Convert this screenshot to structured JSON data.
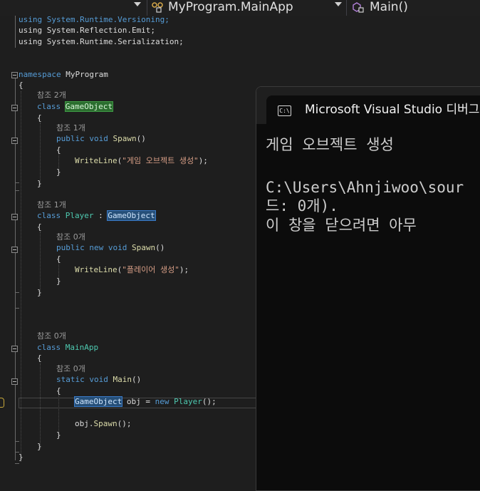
{
  "navbar": {
    "class_dropdown": "MyProgram.MainApp",
    "member_dropdown": "Main()",
    "class_icon": "class-icon",
    "member_icon": "method-icon",
    "dropdown_icon": "chevron-down-icon"
  },
  "editor": {
    "usings": [
      "using System.Runtime.Versioning;",
      "using System.Reflection.Emit;",
      "using System.Runtime.Serialization;"
    ],
    "ns": {
      "kw": "namespace",
      "name": "MyProgram"
    },
    "brace_open": "{",
    "brace_close": "}",
    "gameobject": {
      "refs": "참조 2개",
      "kw": "class",
      "name": "GameObject",
      "spawn_refs": "참조 1개",
      "spawn_mods": "public void",
      "spawn_name": "Spawn",
      "parens": "()",
      "call": "WriteLine",
      "str": "\"게임 오브젝트 생성\"",
      "call_end": ");",
      "call_open": "("
    },
    "player": {
      "refs": "참조 1개",
      "kw": "class",
      "name": "Player",
      "colon": " : ",
      "base": "GameObject",
      "spawn_refs": "참조 0개",
      "spawn_mods": "public new void",
      "spawn_name": "Spawn",
      "parens": "()",
      "call": "WriteLine",
      "str": "\"플레이어 생성\"",
      "call_open": "(",
      "call_end": ");"
    },
    "mainapp": {
      "refs": "참조 0개",
      "kw": "class",
      "name": "MainApp",
      "main_refs": "참조 0개",
      "main_mods": "static void",
      "main_name": "Main",
      "parens": "()",
      "decl_type": "GameObject",
      "decl_var": " obj = ",
      "decl_new": "new",
      "decl_ctor": "Player",
      "decl_end": "();",
      "call_obj": "obj.",
      "call_fn": "Spawn",
      "call_end": "();"
    }
  },
  "console": {
    "title": "Microsoft Visual Studio 디버그",
    "icon_text": "C:\\",
    "icon": "terminal-icon",
    "lines": [
      "게임 오브젝트 생성",
      "",
      "C:\\Users\\Ahnjiwoo\\sour",
      "드: 0개).",
      "이 창을 닫으려면 아무"
    ]
  },
  "colors": {
    "editor_bg": "#1e1e1e",
    "keyword": "#569cd6",
    "type": "#4ec9b0",
    "method": "#dcdcaa",
    "string": "#d69d85",
    "console_bg": "#0c0c0c"
  }
}
